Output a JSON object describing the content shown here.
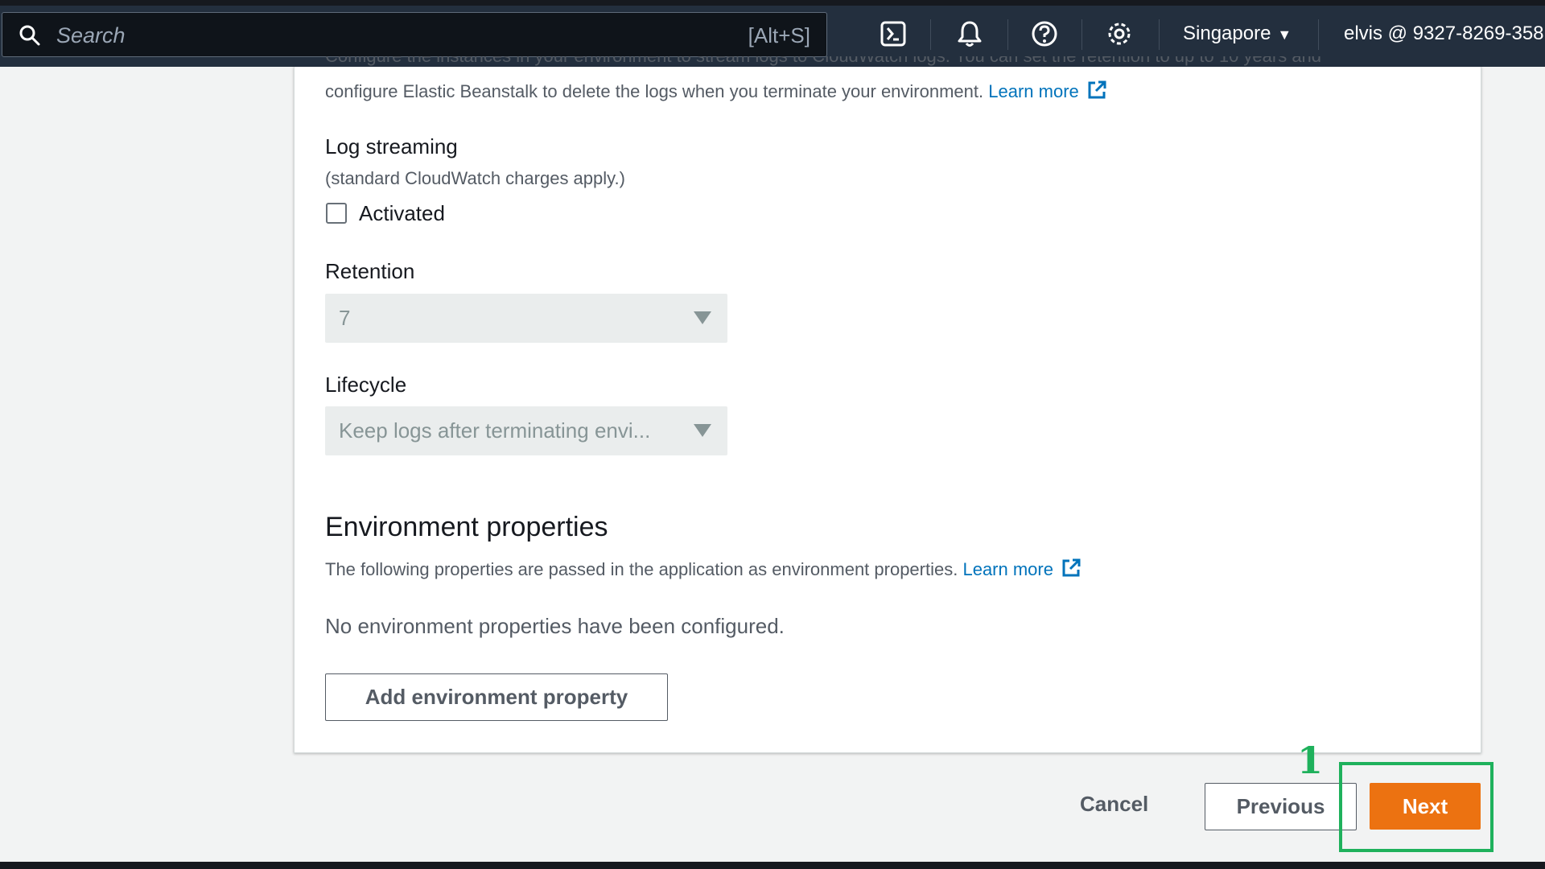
{
  "nav": {
    "search_placeholder": "Search",
    "search_shortcut": "[Alt+S]",
    "icons": [
      "cloudshell-icon",
      "bell-icon",
      "help-icon",
      "gear-icon"
    ],
    "region": "Singapore",
    "account": "elvis @ 9327-8269-358"
  },
  "logs": {
    "clipped_line": "Configure the instances in your environment to stream logs to CloudWatch logs. You can set the retention to up to 10 years and",
    "description": "configure Elastic Beanstalk to delete the logs when you terminate your environment.",
    "learn_more": "Learn more",
    "streaming_label": "Log streaming",
    "streaming_note": "(standard CloudWatch charges apply.)",
    "activated_label": "Activated",
    "activated_checked": false,
    "retention_label": "Retention",
    "retention_value": "7",
    "lifecycle_label": "Lifecycle",
    "lifecycle_value": "Keep logs after terminating envi..."
  },
  "env_props": {
    "heading": "Environment properties",
    "description": "The following properties are passed in the application as environment properties.",
    "learn_more": "Learn more",
    "empty_text": "No environment properties have been configured.",
    "add_button": "Add environment property"
  },
  "footer": {
    "cancel": "Cancel",
    "previous": "Previous",
    "next": "Next"
  },
  "annotation": {
    "step": "1",
    "color": "#1fb15c"
  },
  "colors": {
    "nav_bg": "#232f3e",
    "primary": "#ec7211",
    "link": "#0073bb"
  }
}
